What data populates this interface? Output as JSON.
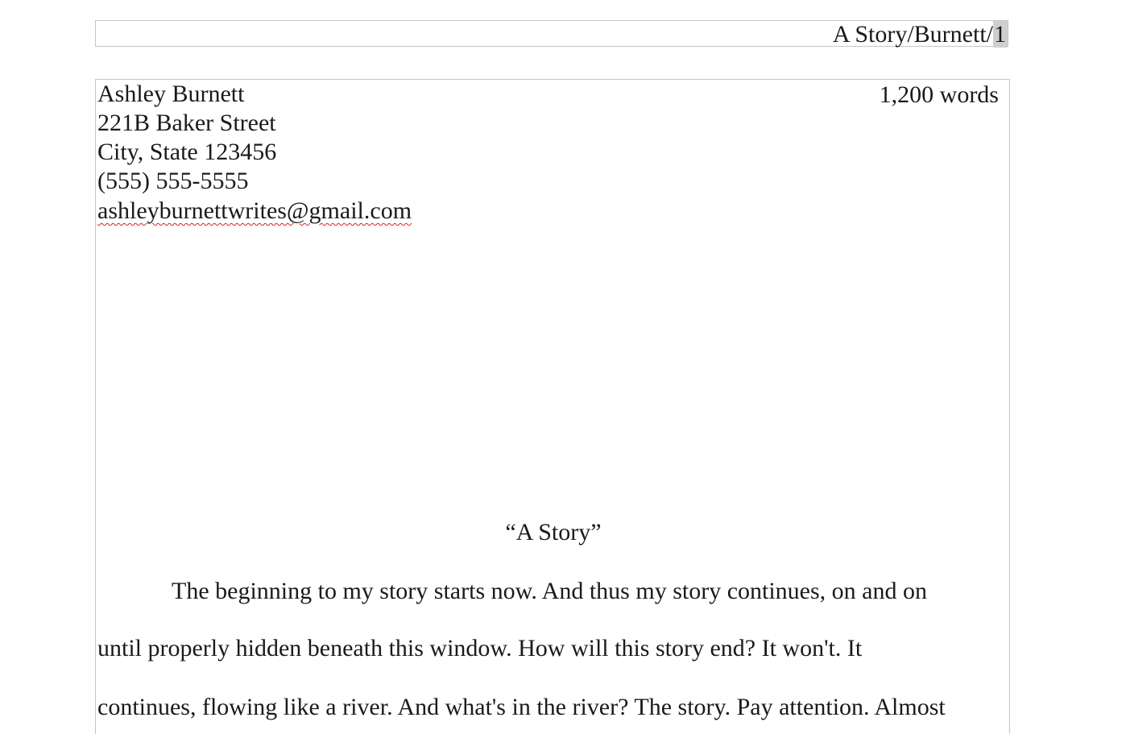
{
  "header": {
    "running_head": "A Story/Burnett/",
    "page_number": "1"
  },
  "contact": {
    "name": "Ashley Burnett",
    "address": "221B Baker Street",
    "city_state": "City, State 123456",
    "phone": "(555) 555-5555",
    "email": "ashleyburnettwrites@gmail.com"
  },
  "word_count": "1,200 words",
  "story": {
    "title": "“A Story”",
    "lines": [
      "The beginning to my story starts now. And thus my story continues, on and on",
      "until properly hidden beneath this window. How will this story end? It won't. It",
      "continues, flowing like a river. And what's in the river? The story. Pay attention. Almost"
    ]
  }
}
